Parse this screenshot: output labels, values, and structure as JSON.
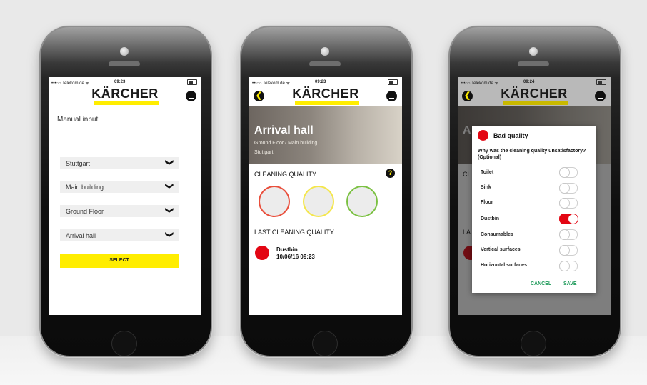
{
  "colors": {
    "brand_yellow": "#ffed00",
    "danger_red": "#e30613",
    "action_green": "#1e9a5a"
  },
  "status": {
    "carrier": "•••○○ Telekom.de ᯤ",
    "time_1": "09:23",
    "time_2": "09:23",
    "time_3": "09:24"
  },
  "brand": {
    "logo": "KÄRCHER"
  },
  "screen1": {
    "title": "Manual input",
    "dropdowns": [
      {
        "label": "Stuttgart"
      },
      {
        "label": "Main building"
      },
      {
        "label": "Ground Floor"
      },
      {
        "label": "Arrival hall"
      }
    ],
    "chevron": "❯",
    "select_label": "SELECT"
  },
  "screen2": {
    "back_icon": "❮",
    "hero_title": "Arrival hall",
    "hero_sub": "Ground Floor / Main building",
    "hero_city": "Stuttgart",
    "quality_title": "CLEANING QUALITY",
    "help": "?",
    "rings": [
      {
        "color": "#e94e3b"
      },
      {
        "color": "#f4e64a"
      },
      {
        "color": "#7bc142"
      }
    ],
    "last_title": "LAST CLEANING QUALITY",
    "last_item": "Dustbin",
    "last_date": "10/06/16 09:23"
  },
  "screen3": {
    "bg_hero_letter": "A",
    "bg_cl": "CL",
    "bg_la": "LA",
    "dialog_title": "Bad quality",
    "dialog_question": "Why was the cleaning quality unsatisfactory? (Optional)",
    "options": [
      {
        "label": "Toilet",
        "on": false
      },
      {
        "label": "Sink",
        "on": false
      },
      {
        "label": "Floor",
        "on": false
      },
      {
        "label": "Dustbin",
        "on": true
      },
      {
        "label": "Consumables",
        "on": false
      },
      {
        "label": "Vertical surfaces",
        "on": false
      },
      {
        "label": "Horizontal surfaces",
        "on": false
      }
    ],
    "cancel": "CANCEL",
    "save": "SAVE"
  }
}
